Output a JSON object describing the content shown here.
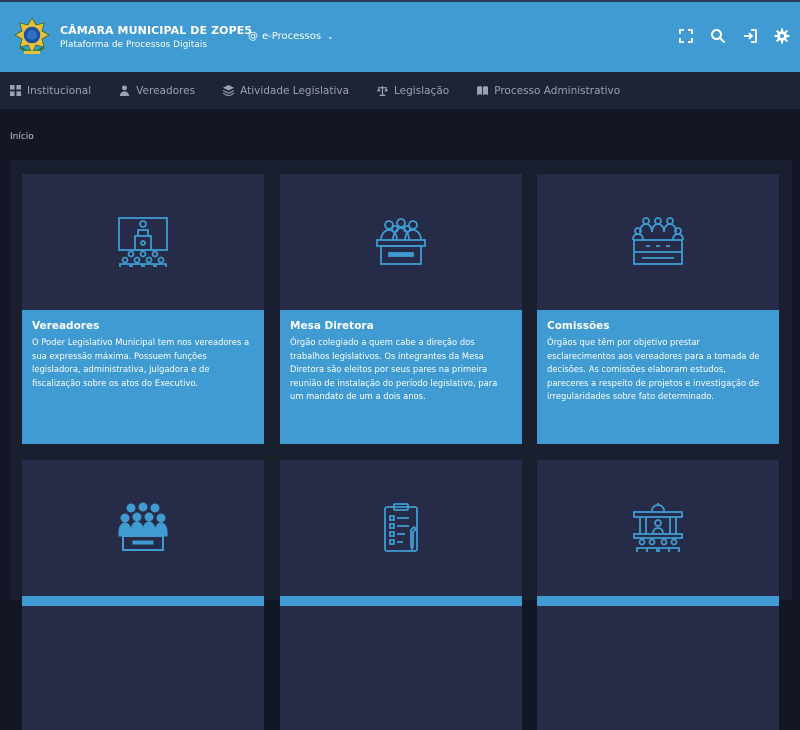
{
  "header": {
    "title": "CÂMARA MUNICIPAL DE ZOPE5",
    "subtitle": "Plataforma de Processos Digitais",
    "module_prefix": "@",
    "module_label": "e-Processos",
    "icons": [
      "fullscreen-icon",
      "search-icon",
      "login-icon",
      "gear-icon"
    ]
  },
  "nav": {
    "items": [
      {
        "label": "Institucional",
        "icon": "grid-icon"
      },
      {
        "label": "Vereadores",
        "icon": "user-icon"
      },
      {
        "label": "Atividade Legislativa",
        "icon": "layers-icon"
      },
      {
        "label": "Legislação",
        "icon": "scales-icon"
      },
      {
        "label": "Processo Administrativo",
        "icon": "book-icon"
      }
    ]
  },
  "breadcrumb": "Início",
  "cards": [
    {
      "title": "Vereadores",
      "icon": "podium-icon",
      "desc": "O Poder Legislativo Municipal tem nos vereadores a sua expressão máxima. Possuem funções legisladora, administrativa, julgadora e de fiscalização sobre os atos do Executivo."
    },
    {
      "title": "Mesa Diretora",
      "icon": "board-icon",
      "desc": "Órgão colegiado a quem cabe a direção dos trabalhos legislativos. Os integrantes da Mesa Diretora são eleitos por seus pares na primeira reunião de instalação do período legislativo, para um mandato de um a dois anos."
    },
    {
      "title": "Comissões",
      "icon": "committee-icon",
      "desc": "Órgãos que têm por objetivo prestar esclarecimentos aos vereadores para a tomada de decisões. As comissões elaboram estudos, pareceres a respeito de projetos e investigação de irregularidades sobre fato determinado."
    },
    {
      "title": "",
      "icon": "plenary-icon",
      "desc": ""
    },
    {
      "title": "",
      "icon": "clipboard-icon",
      "desc": ""
    },
    {
      "title": "",
      "icon": "chamber-icon",
      "desc": ""
    }
  ],
  "colors": {
    "header_bg": "#3f9bd2",
    "nav_bg": "#1e2436",
    "page_bg": "#131725",
    "card_bg": "#262c47",
    "accent": "#3f9bd2"
  }
}
